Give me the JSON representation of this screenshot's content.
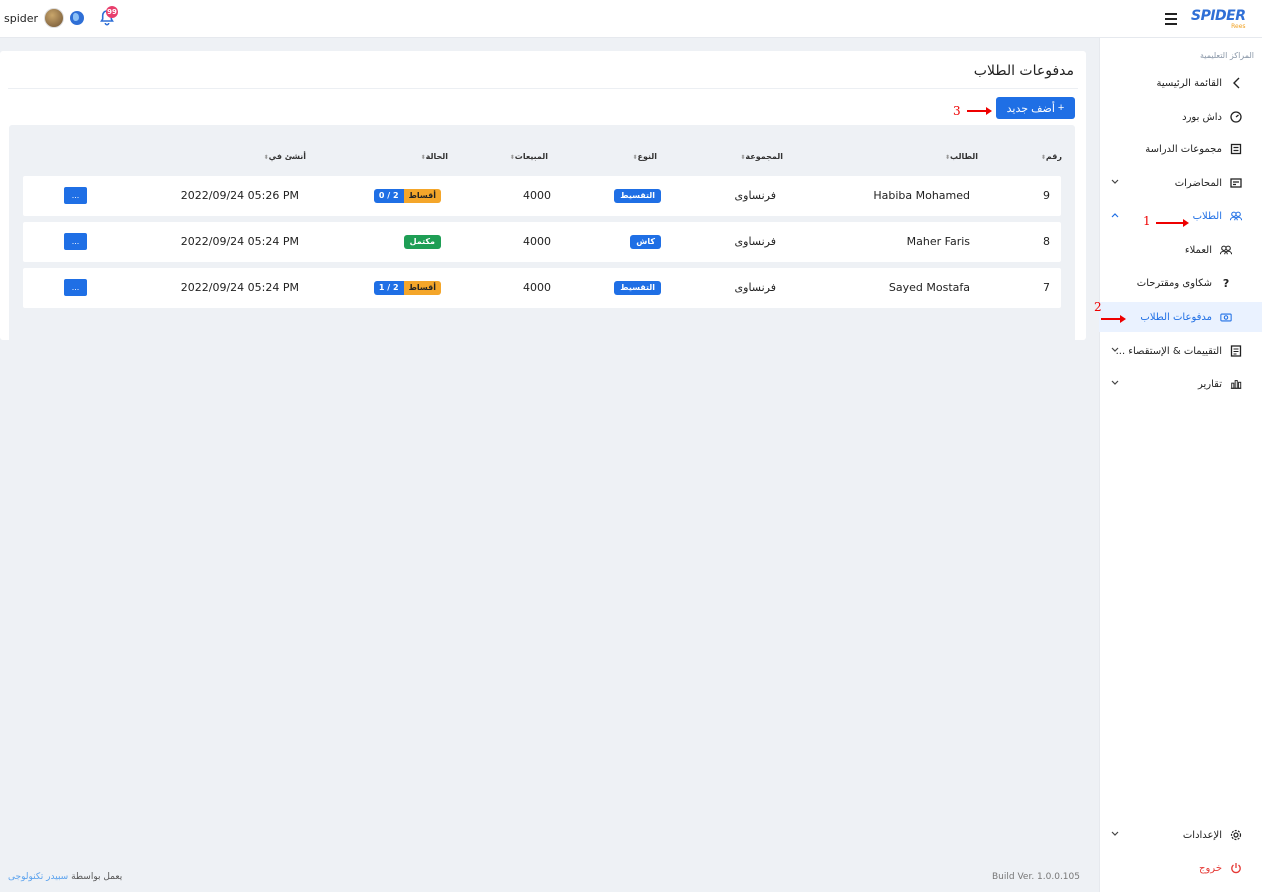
{
  "topbar": {
    "username": "spider",
    "notifications_count": "99",
    "logo_text": "SPIDER",
    "logo_sub": "Rees"
  },
  "sidebar": {
    "section_title": "المراكز التعليمية",
    "items": [
      {
        "label": "القائمة الرئيسية",
        "icon": "chevron-left-icon"
      },
      {
        "label": "داش بورد",
        "icon": "dashboard-icon"
      },
      {
        "label": "مجموعات الدراسة",
        "icon": "groups-icon"
      },
      {
        "label": "المحاضرات",
        "icon": "lectures-icon"
      },
      {
        "label": "الطلاب",
        "icon": "users-icon"
      },
      {
        "label": "العملاء",
        "icon": "users-icon"
      },
      {
        "label": "شكاوى ومقترحات",
        "icon": "question-icon"
      },
      {
        "label": "مدفوعات الطلاب",
        "icon": "payments-icon"
      },
      {
        "label": "التقييمات & الإستقصاء ...",
        "icon": "document-icon"
      },
      {
        "label": "تقارير",
        "icon": "bar-chart-icon"
      }
    ],
    "settings_label": "الإعدادات",
    "logout_label": "خروج"
  },
  "main": {
    "title": "مدفوعات الطلاب",
    "add_button": "أضف جديد",
    "columns": [
      "رقم",
      "الطالب",
      "المجموعة",
      "النوع",
      "المبيعات",
      "الحالة",
      "أنشئ في"
    ],
    "rows": [
      {
        "id": "9",
        "student": "Habiba Mohamed",
        "group": "فرنساوى",
        "type": "التقسيط",
        "sales": "4000",
        "status_kind": "installments",
        "status_label": "أقساط",
        "status_count": "2 / 0",
        "created": "2022/09/24 05:26 PM"
      },
      {
        "id": "8",
        "student": "Maher Faris",
        "group": "فرنساوى",
        "type": "كاش",
        "sales": "4000",
        "status_kind": "complete",
        "status_label": "مكتمل",
        "status_count": "",
        "created": "2022/09/24 05:24 PM"
      },
      {
        "id": "7",
        "student": "Sayed Mostafa",
        "group": "فرنساوى",
        "type": "التقسيط",
        "sales": "4000",
        "status_kind": "installments",
        "status_label": "أقساط",
        "status_count": "2 / 1",
        "created": "2022/09/24 05:24 PM"
      }
    ],
    "actions_label": "..."
  },
  "annotations": [
    "1",
    "2",
    "3"
  ],
  "footer": {
    "powered_prefix": "يعمل بواسطة",
    "powered_link": "سبيدر تكنولوجى",
    "build": "Build Ver. 1.0.0.105"
  },
  "colors": {
    "primary": "#1f6fe5",
    "success": "#1e9e55",
    "warning": "#f4a62a",
    "danger": "#e53935"
  }
}
